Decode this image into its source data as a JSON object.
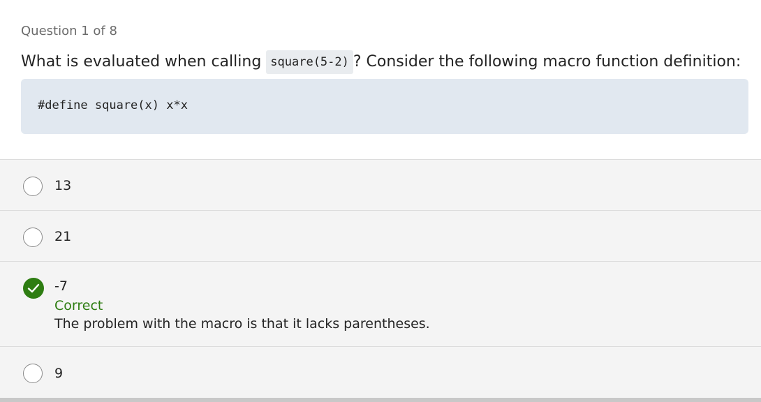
{
  "quiz": {
    "counter": "Question 1 of 8",
    "question_before": "What is evaluated when calling ",
    "question_code": "square(5-2)",
    "question_after": "? Consider the following macro function definition:",
    "code_block": "#define square(x) x*x"
  },
  "options": [
    {
      "label": "13",
      "selected": false
    },
    {
      "label": "21",
      "selected": false
    },
    {
      "label": "-7",
      "selected": true,
      "feedback_title": "Correct",
      "feedback_text": "The problem with the macro is that it lacks parentheses."
    },
    {
      "label": "9",
      "selected": false
    }
  ],
  "colors": {
    "correct_green": "#2e7d12",
    "code_block_bg": "#e1e8f0",
    "options_bg": "#f4f4f4"
  },
  "icons": {
    "selected_option": "checkmark-circle-icon",
    "unselected_option": "radio-empty-icon"
  }
}
